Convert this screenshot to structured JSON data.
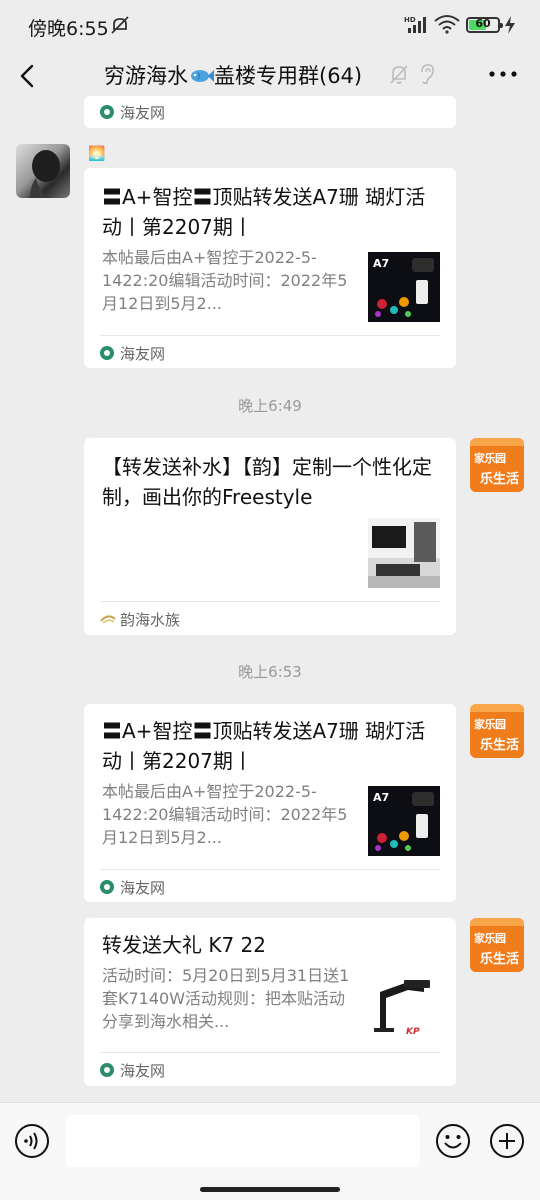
{
  "status_bar": {
    "time": "傍晚6:55",
    "network": "HD",
    "battery": "60",
    "battery_level": 0.6
  },
  "header": {
    "title_prefix": "穷游海水",
    "title_suffix": "盖楼专用群(64)",
    "icons": [
      "back-icon",
      "fish-emoji-icon",
      "mute-bell-icon",
      "ear-icon",
      "more-icon"
    ]
  },
  "messages": [
    {
      "type": "card-tail",
      "source": "海友网"
    },
    {
      "type": "card",
      "sender_side": "left",
      "sender_name": "🌅",
      "title": "〓A+智控〓顶贴转发送A7珊 瑚灯活动丨第2207期丨",
      "description": "本帖最后由A+智控于2022-5-1422:20编辑活动时间：2022年5月12日到5月2...",
      "thumb_label": "A7",
      "source": "海友网"
    },
    {
      "type": "time",
      "text": "晚上6:49"
    },
    {
      "type": "card",
      "sender_side": "right",
      "title": "【转发送补水】【韵】定制一个性化定制，画出你的Freestyle",
      "source": "韵海水族"
    },
    {
      "type": "time",
      "text": "晚上6:53"
    },
    {
      "type": "card",
      "sender_side": "right",
      "title": "〓A+智控〓顶贴转发送A7珊 瑚灯活动丨第2207期丨",
      "description": "本帖最后由A+智控于2022-5-1422:20编辑活动时间：2022年5月12日到5月2...",
      "thumb_label": "A7",
      "source": "海友网"
    },
    {
      "type": "card",
      "sender_side": "right",
      "title": "转发送大礼 K7 22",
      "description": "活动时间：5月20日到5月31日送1套K7140W活动规则：把本贴活动分享到海水相关...",
      "source": "海友网"
    }
  ],
  "avatar_badge": {
    "line1": "家乐园",
    "line2": "乐生活"
  },
  "input_bar": {
    "placeholder": ""
  }
}
